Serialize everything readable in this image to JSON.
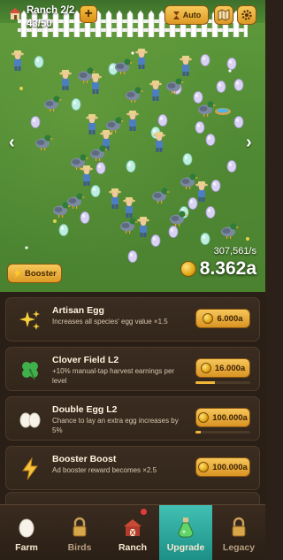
{
  "hud": {
    "ranch_label": "Ranch 2/2",
    "capacity_label": "43/50",
    "auto_label": "Auto",
    "icons": [
      "house-icon",
      "plus-icon",
      "hourglass-icon",
      "map-icon",
      "gear-icon"
    ]
  },
  "field": {
    "rate_label": "307,561/s",
    "total_label": "8.362a",
    "booster_label": "Booster"
  },
  "upgrades": [
    {
      "title": "Artisan Egg",
      "desc": "Increases all species' egg value ×1.5",
      "price": "6.000a",
      "icon": "sparkles-icon",
      "progress": null
    },
    {
      "title": "Clover Field L2",
      "desc": "+10% manual-tap harvest earnings per level",
      "price": "16.000a",
      "icon": "clover-icon",
      "progress": 0.35
    },
    {
      "title": "Double Egg L2",
      "desc": "Chance to lay an extra egg increases by 5%",
      "price": "100.000a",
      "icon": "eggs-icon",
      "progress": 0.1
    },
    {
      "title": "Booster Boost",
      "desc": "Ad booster reward becomes ×2.5",
      "price": "100.000a",
      "icon": "lightning-icon",
      "progress": null
    },
    {
      "title": "",
      "desc": "",
      "price": "",
      "icon": "partial",
      "progress": null
    }
  ],
  "nav": {
    "farm": "Farm",
    "birds": "Birds",
    "ranch": "Ranch",
    "upgrade": "Upgrade",
    "legacy": "Legacy",
    "active": "Upgrade"
  },
  "colors": {
    "grass": "#4f8a33",
    "panel": "#2a1f17",
    "accent_gold": "#f2b738",
    "active_tab": "#2aa89d",
    "notification": "#e03b3b"
  }
}
